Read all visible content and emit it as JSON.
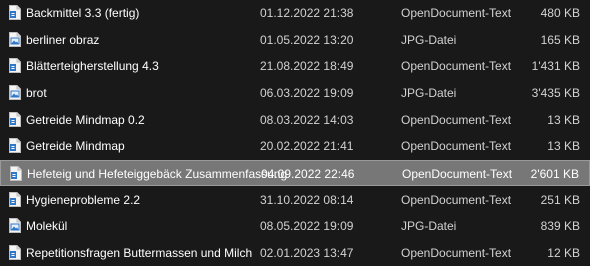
{
  "files": [
    {
      "name": "Backmittel 3.3 (fertig)",
      "modified": "01.12.2022 21:38",
      "type": "OpenDocument-Text",
      "size": "480 KB",
      "icon": "odt-file-icon",
      "selected": false
    },
    {
      "name": "berliner obraz",
      "modified": "01.05.2022 13:20",
      "type": "JPG-Datei",
      "size": "165 KB",
      "icon": "jpg-file-icon",
      "selected": false
    },
    {
      "name": "Blätterteigherstellung 4.3",
      "modified": "21.08.2022 18:49",
      "type": "OpenDocument-Text",
      "size": "1'431 KB",
      "icon": "odt-file-icon",
      "selected": false
    },
    {
      "name": "brot",
      "modified": "06.03.2022 19:09",
      "type": "JPG-Datei",
      "size": "3'435 KB",
      "icon": "jpg-file-icon",
      "selected": false
    },
    {
      "name": "Getreide Mindmap 0.2",
      "modified": "08.03.2022 14:03",
      "type": "OpenDocument-Text",
      "size": "13 KB",
      "icon": "odt-file-icon",
      "selected": false
    },
    {
      "name": "Getreide Mindmap",
      "modified": "20.02.2022 21:41",
      "type": "OpenDocument-Text",
      "size": "13 KB",
      "icon": "odt-file-icon",
      "selected": false
    },
    {
      "name": "Hefeteig und Hefeteiggebäck Zusammenfassung",
      "modified": "04.09.2022 22:46",
      "type": "OpenDocument-Text",
      "size": "2'601 KB",
      "icon": "odt-file-icon",
      "selected": true
    },
    {
      "name": "Hygieneprobleme 2.2",
      "modified": "31.10.2022 08:14",
      "type": "OpenDocument-Text",
      "size": "251 KB",
      "icon": "odt-file-icon",
      "selected": false
    },
    {
      "name": "Molekül",
      "modified": "08.05.2022 19:09",
      "type": "JPG-Datei",
      "size": "839 KB",
      "icon": "jpg-file-icon",
      "selected": false
    },
    {
      "name": "Repetitionsfragen Buttermassen und Milch",
      "modified": "02.01.2023 13:47",
      "type": "OpenDocument-Text",
      "size": "12 KB",
      "icon": "odt-file-icon",
      "selected": false
    }
  ],
  "colors": {
    "background": "#191919",
    "selected_row": "#777777",
    "selected_border": "#9a9a9a",
    "text_primary": "#ffffff",
    "text_secondary": "#d2d2d2",
    "odt_icon_accent": "#2f78c8",
    "jpg_icon_accent": "#2f78c8"
  }
}
